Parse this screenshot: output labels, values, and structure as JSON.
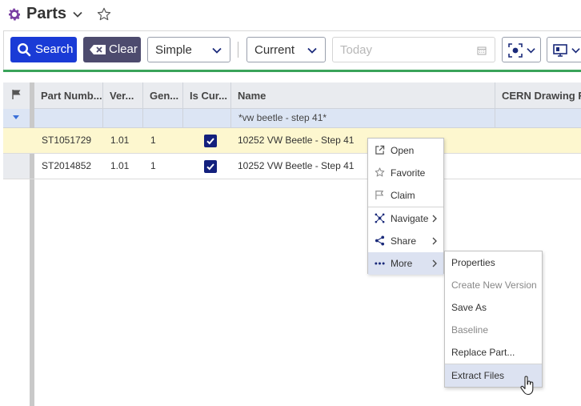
{
  "header": {
    "title": "Parts",
    "icons": [
      "gear-icon",
      "chevron-down-icon",
      "star-outline-icon"
    ]
  },
  "toolbar": {
    "search_label": "Search",
    "clear_label": "Clear",
    "mode_value": "Simple",
    "version_value": "Current",
    "date_placeholder": "Today",
    "accent_color": "#1a3bd6",
    "clear_color": "#4d4b6e",
    "status_line_color": "#3aa35a"
  },
  "grid": {
    "columns": [
      "Part Numb...",
      "Ver...",
      "Gen...",
      "Is Cur...",
      "Name",
      "CERN Drawing Ref"
    ],
    "filter": {
      "name": "*vw beetle - step 41*"
    },
    "rows": [
      {
        "part_number": "ST1051729",
        "version": "1.01",
        "generation": "1",
        "is_current": true,
        "name": "10252 VW Beetle - Step 41",
        "selected": true
      },
      {
        "part_number": "ST2014852",
        "version": "1.01",
        "generation": "1",
        "is_current": true,
        "name": "10252 VW Beetle - Step 41",
        "selected": false
      }
    ],
    "selected_row_color": "#fdf7cf"
  },
  "context_menu": {
    "items": [
      {
        "label": "Open",
        "icon": "external-link-icon"
      },
      {
        "label": "Favorite",
        "icon": "star-outline-icon"
      },
      {
        "label": "Claim",
        "icon": "flag-icon"
      },
      {
        "label": "Navigate",
        "icon": "network-icon",
        "submenu": true
      },
      {
        "label": "Share",
        "icon": "share-icon",
        "submenu": true
      },
      {
        "label": "More",
        "icon": "more-dots-icon",
        "submenu": true,
        "highlighted": true
      }
    ],
    "submenu": {
      "items": [
        {
          "label": "Properties",
          "disabled": false
        },
        {
          "label": "Create New Version",
          "disabled": true
        },
        {
          "label": "Save As",
          "disabled": false
        },
        {
          "label": "Baseline",
          "disabled": true
        },
        {
          "label": "Replace Part...",
          "disabled": false
        },
        {
          "label": "Extract Files",
          "disabled": false,
          "highlighted": true
        }
      ]
    }
  }
}
